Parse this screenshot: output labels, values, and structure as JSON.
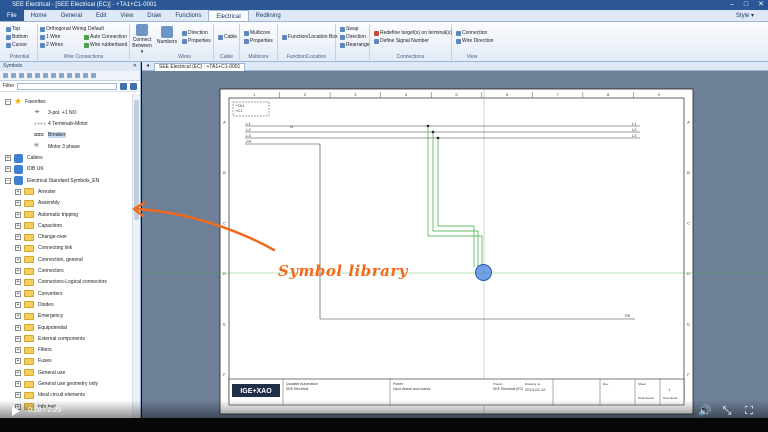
{
  "window": {
    "title": "SEE Electrical - [SEE Electrical (EC)] - +TA1+C1-0001",
    "controls": [
      "–",
      "□",
      "✕"
    ]
  },
  "ribbon_tabs": [
    {
      "label": "File"
    },
    {
      "label": "Home"
    },
    {
      "label": "General"
    },
    {
      "label": "Edit"
    },
    {
      "label": "View"
    },
    {
      "label": "Draw"
    },
    {
      "label": "Functions"
    },
    {
      "label": "Electrical"
    },
    {
      "label": "Redlining"
    }
  ],
  "style_label": "Style ▾",
  "ribbon": {
    "potential": {
      "name": "Potential",
      "items": [
        "Top",
        "Bottom",
        "Cursor"
      ]
    },
    "wire_connections": {
      "name": "Wire Connections",
      "items": [
        "Orthogonal Wiring",
        "Default",
        "1 Wire",
        "2 Wires",
        "Auto Connection",
        "Wire rubberband"
      ]
    },
    "connect_between": {
      "label": "Connect Between ▾"
    },
    "wires": {
      "name": "Wires",
      "numbers": "Numbers",
      "items": [
        "Direction",
        "Properties"
      ]
    },
    "cable": {
      "name": "Cable",
      "items": [
        "Cable"
      ]
    },
    "multicore": {
      "name": "Multicore",
      "items": [
        "Multicore",
        "Properties"
      ]
    },
    "function_location": {
      "name": "Function/Location",
      "items": [
        "Function/Location Box"
      ]
    },
    "swap": {
      "items": [
        "Swap",
        "Direction",
        "Rearrange"
      ]
    },
    "connections": {
      "name": "Connections",
      "items": [
        "Redefine target(s) on terminal(s)",
        "Define Signal Number"
      ]
    },
    "view": {
      "name": "View",
      "items": [
        "Connection",
        "Wire Direction"
      ]
    }
  },
  "symbols_panel": {
    "title": "Symbols",
    "close": "✕",
    "filter_label": "Filter",
    "filter_value": "",
    "tree": [
      {
        "label": "Favorites",
        "kind": "star",
        "indent": 0,
        "exp": "−"
      },
      {
        "label": "1 NO",
        "prefix": "3-pol. +",
        "kind": "sym",
        "glyph": "⊣⊢",
        "indent": 2
      },
      {
        "label": "4 Terminals-Motor",
        "kind": "sym",
        "glyph": "∘∘∘∘",
        "indent": 2
      },
      {
        "label": "Breaker",
        "kind": "sym",
        "glyph": "⧄⧄⧄",
        "indent": 2,
        "selected": true
      },
      {
        "label": "Motor 3 phase",
        "kind": "sym",
        "glyph": "Ⓜ",
        "indent": 2
      },
      {
        "label": "Cables",
        "kind": "db",
        "indent": 0,
        "exp": "+"
      },
      {
        "label": "IDB UK",
        "kind": "db",
        "indent": 0,
        "exp": "+"
      },
      {
        "label": "Electrical Standard Symbols_EN",
        "kind": "db",
        "indent": 0,
        "exp": "−"
      },
      {
        "label": "Arrester",
        "kind": "folder",
        "indent": 1,
        "exp": "+"
      },
      {
        "label": "Assembly",
        "kind": "folder",
        "indent": 1,
        "exp": "+"
      },
      {
        "label": "Automatic tripping",
        "kind": "folder",
        "indent": 1,
        "exp": "+"
      },
      {
        "label": "Capacitors",
        "kind": "folder",
        "indent": 1,
        "exp": "+"
      },
      {
        "label": "Change-over",
        "kind": "folder",
        "indent": 1,
        "exp": "+"
      },
      {
        "label": "Connecting link",
        "kind": "folder",
        "indent": 1,
        "exp": "+"
      },
      {
        "label": "Connection, general",
        "kind": "folder",
        "indent": 1,
        "exp": "+"
      },
      {
        "label": "Connectors",
        "kind": "folder",
        "indent": 1,
        "exp": "+"
      },
      {
        "label": "Connectors-Logical connectors",
        "kind": "folder",
        "indent": 1,
        "exp": "+"
      },
      {
        "label": "Converters",
        "kind": "folder",
        "indent": 1,
        "exp": "+"
      },
      {
        "label": "Diodes",
        "kind": "folder",
        "indent": 1,
        "exp": "+"
      },
      {
        "label": "Emergency",
        "kind": "folder",
        "indent": 1,
        "exp": "+"
      },
      {
        "label": "Equipotential",
        "kind": "folder",
        "indent": 1,
        "exp": "+"
      },
      {
        "label": "External components",
        "kind": "folder",
        "indent": 1,
        "exp": "+"
      },
      {
        "label": "Filters",
        "kind": "folder",
        "indent": 1,
        "exp": "+"
      },
      {
        "label": "Fuses",
        "kind": "folder",
        "indent": 1,
        "exp": "+"
      },
      {
        "label": "General use",
        "kind": "folder",
        "indent": 1,
        "exp": "+"
      },
      {
        "label": "General use geometry only",
        "kind": "folder",
        "indent": 1,
        "exp": "+"
      },
      {
        "label": "Ideal circuit elements",
        "kind": "folder",
        "indent": 1,
        "exp": "+"
      },
      {
        "label": "Info text",
        "kind": "folder",
        "indent": 1,
        "exp": "+"
      }
    ]
  },
  "document_tab": {
    "label": "SEE Electrical (EC) : +TA1+C1-0001"
  },
  "drawing": {
    "top_numbers": [
      "1",
      "2",
      "3",
      "4",
      "5",
      "6",
      "7",
      "8",
      "9"
    ],
    "side_letters": [
      "A",
      "B",
      "C",
      "D",
      "E",
      "F"
    ],
    "left_labels": [
      "-L1",
      "-L2",
      "-L3",
      "-PE"
    ],
    "right_labels": [
      "L1",
      "L2",
      "L3"
    ],
    "n_label": "N",
    "box_labels": [
      "+TA1",
      "+C1"
    ],
    "title_block": {
      "logo": "IGE+XAO",
      "company": [
        "Quadate Automation",
        "SEE Electrical"
      ],
      "desc": [
        "Power",
        "Input device and motors"
      ],
      "project_label": "Project",
      "project": "SEE Electrical (EC)",
      "drawing_no_label": "Drawing no.",
      "date": "2013-02-12",
      "rev_label": "Rev.",
      "sheet_label": "Sheet",
      "sheet": "1",
      "total_label": "Total sheets",
      "next_label": "Next sheet"
    }
  },
  "annotation": {
    "text": "Symbol library",
    "color": "#f26a1b"
  },
  "video": {
    "time": "0:10 / 2:29"
  }
}
